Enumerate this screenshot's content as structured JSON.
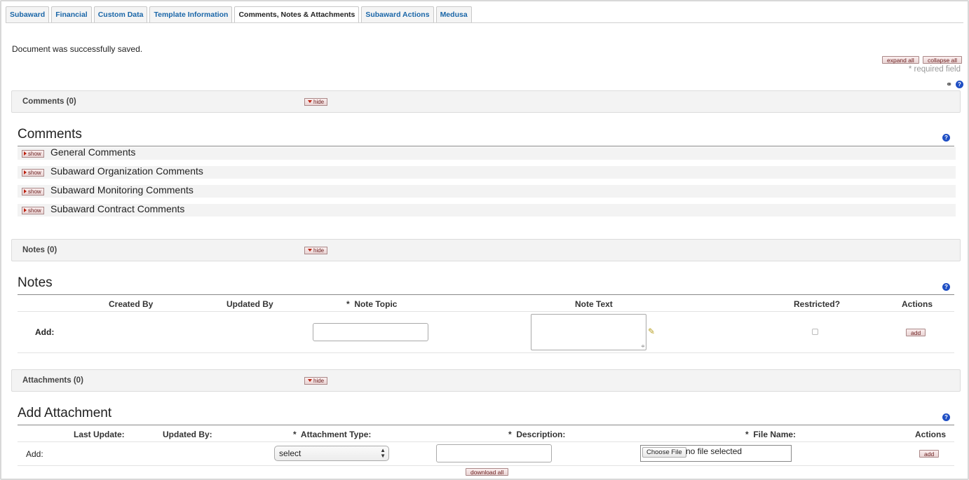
{
  "tabs": [
    {
      "label": "Subaward",
      "active": false
    },
    {
      "label": "Financial",
      "active": false
    },
    {
      "label": "Custom Data",
      "active": false
    },
    {
      "label": "Template Information",
      "active": false
    },
    {
      "label": "Comments, Notes & Attachments",
      "active": true
    },
    {
      "label": "Subaward Actions",
      "active": false
    },
    {
      "label": "Medusa",
      "active": false
    }
  ],
  "message": "Document was successfully saved.",
  "toolbar": {
    "expand_all": "expand all",
    "collapse_all": "collapse all",
    "required_note": "* required field"
  },
  "comments_section": {
    "bar_label": "Comments (0)",
    "hide_label": "hide",
    "title": "Comments",
    "show_label": "show",
    "subsections": [
      "General Comments",
      "Subaward Organization Comments",
      "Subaward Monitoring Comments",
      "Subaward Contract Comments"
    ]
  },
  "notes_section": {
    "bar_label": "Notes (0)",
    "hide_label": "hide",
    "title": "Notes",
    "columns": {
      "created_by": "Created By",
      "updated_by": "Updated By",
      "note_topic": "Note Topic",
      "note_text": "Note Text",
      "restricted": "Restricted?",
      "actions": "Actions"
    },
    "required_mark": "*",
    "add_row_label": "Add:",
    "add_button": "add"
  },
  "attachments_section": {
    "bar_label": "Attachments (0)",
    "hide_label": "hide",
    "title": "Add Attachment",
    "columns": {
      "last_update": "Last Update:",
      "updated_by": "Updated By:",
      "attachment_type": "Attachment Type:",
      "description": "Description:",
      "file_name": "File Name:",
      "actions": "Actions"
    },
    "required_mark": "*",
    "add_row_label": "Add:",
    "type_select_value": "select",
    "choose_file": "Choose File",
    "no_file": "no file selected",
    "add_button": "add",
    "download_all": "download all"
  }
}
